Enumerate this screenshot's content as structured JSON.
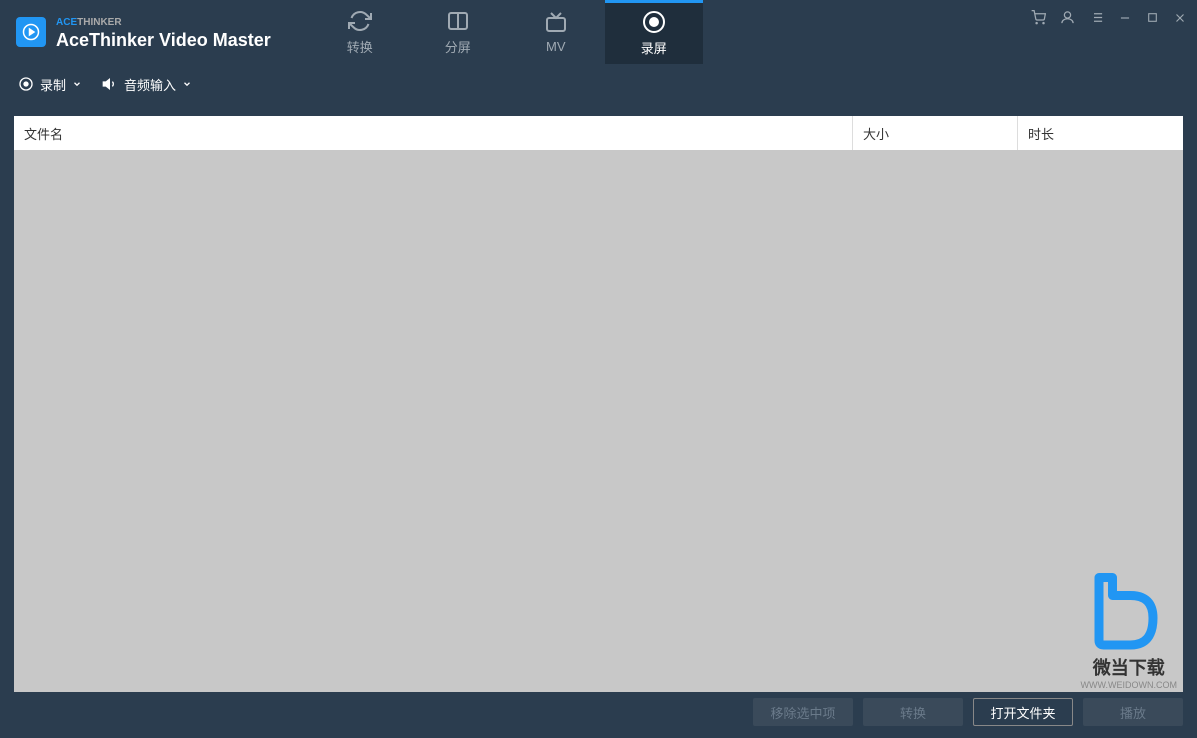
{
  "brand": {
    "prefix": "ACE",
    "suffix": "THINKER"
  },
  "app_title": "AceThinker Video Master",
  "tabs": {
    "convert": "转换",
    "split": "分屏",
    "mv": "MV",
    "record": "录屏"
  },
  "toolbar": {
    "record": "录制",
    "audio_input": "音频输入"
  },
  "table": {
    "filename": "文件名",
    "size": "大小",
    "duration": "时长"
  },
  "buttons": {
    "remove_selected": "移除选中项",
    "convert": "转换",
    "open_folder": "打开文件夹",
    "play": "播放"
  },
  "watermark": {
    "text": "微当下载",
    "url": "WWW.WEIDOWN.COM"
  }
}
